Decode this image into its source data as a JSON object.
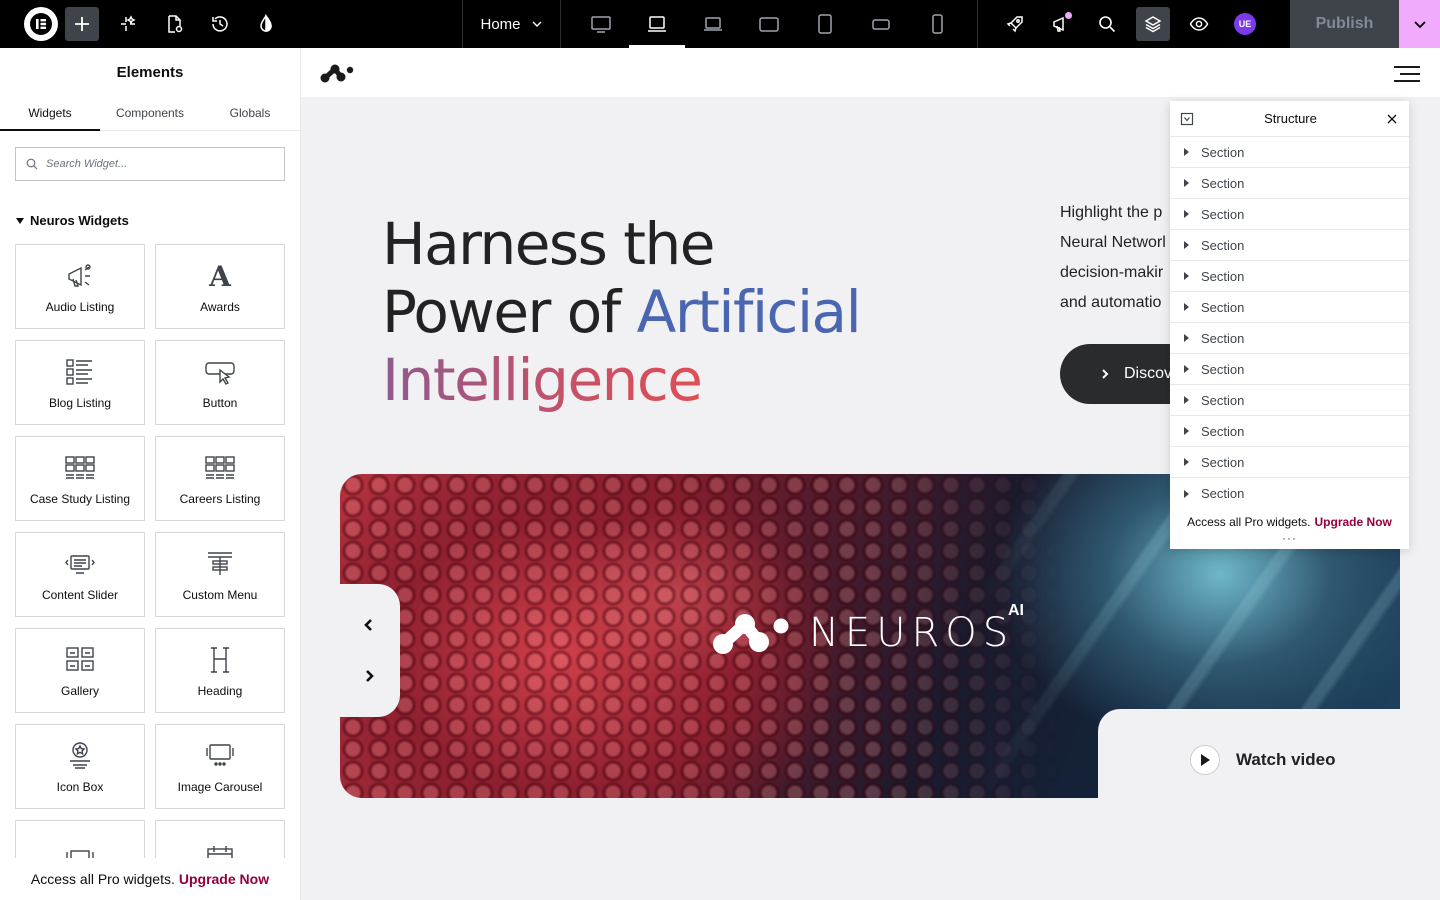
{
  "topbar": {
    "page_selector": "Home",
    "publish_label": "Publish",
    "avatar_initials": "UE",
    "devices": [
      "desktop",
      "laptop",
      "widescreen-laptop",
      "tablet-landscape",
      "tablet-portrait",
      "mobile-landscape",
      "mobile-portrait"
    ],
    "active_device": "laptop"
  },
  "panel": {
    "title": "Elements",
    "tabs": [
      "Widgets",
      "Components",
      "Globals"
    ],
    "active_tab": "Widgets",
    "search_placeholder": "Search Widget...",
    "category": "Neuros Widgets",
    "widgets": [
      {
        "label": "Audio Listing",
        "icon": "megaphone-icon"
      },
      {
        "label": "Awards",
        "icon": "letter-a-icon"
      },
      {
        "label": "Blog Listing",
        "icon": "list-icon"
      },
      {
        "label": "Button",
        "icon": "cursor-button-icon"
      },
      {
        "label": "Case Study Listing",
        "icon": "grid-icon"
      },
      {
        "label": "Careers Listing",
        "icon": "grid-icon"
      },
      {
        "label": "Content Slider",
        "icon": "slider-icon"
      },
      {
        "label": "Custom Menu",
        "icon": "menu-icon"
      },
      {
        "label": "Gallery",
        "icon": "gallery-icon"
      },
      {
        "label": "Heading",
        "icon": "heading-icon"
      },
      {
        "label": "Icon Box",
        "icon": "icon-box-icon"
      },
      {
        "label": "Image Carousel",
        "icon": "carousel-icon"
      },
      {
        "label": "",
        "icon": "slides-icon"
      },
      {
        "label": "",
        "icon": "price-table-icon"
      }
    ],
    "footer_text": "Access all Pro widgets.",
    "footer_link": "Upgrade Now"
  },
  "hero": {
    "line1": "Harness the",
    "line2a": "Power of ",
    "line2b": "Artificial",
    "line3": "Intelligence",
    "desc": [
      "Highlight the p",
      "Neural Networl",
      "decision-makir",
      "and automatio"
    ],
    "cta": "Discov"
  },
  "banner": {
    "brand": "NEUROS",
    "brand_sup": "AI",
    "watch_video": "Watch video"
  },
  "structure": {
    "title": "Structure",
    "rows": [
      "Section",
      "Section",
      "Section",
      "Section",
      "Section",
      "Section",
      "Section",
      "Section",
      "Section",
      "Section",
      "Section",
      "Section"
    ],
    "footer_text": "Access all Pro widgets.",
    "footer_link": "Upgrade Now"
  },
  "colors": {
    "accent_pink": "#f0abfc",
    "upgrade_link": "#93003f",
    "heading_blue": "#4b66b0",
    "heading_warm": "#e14d53"
  }
}
